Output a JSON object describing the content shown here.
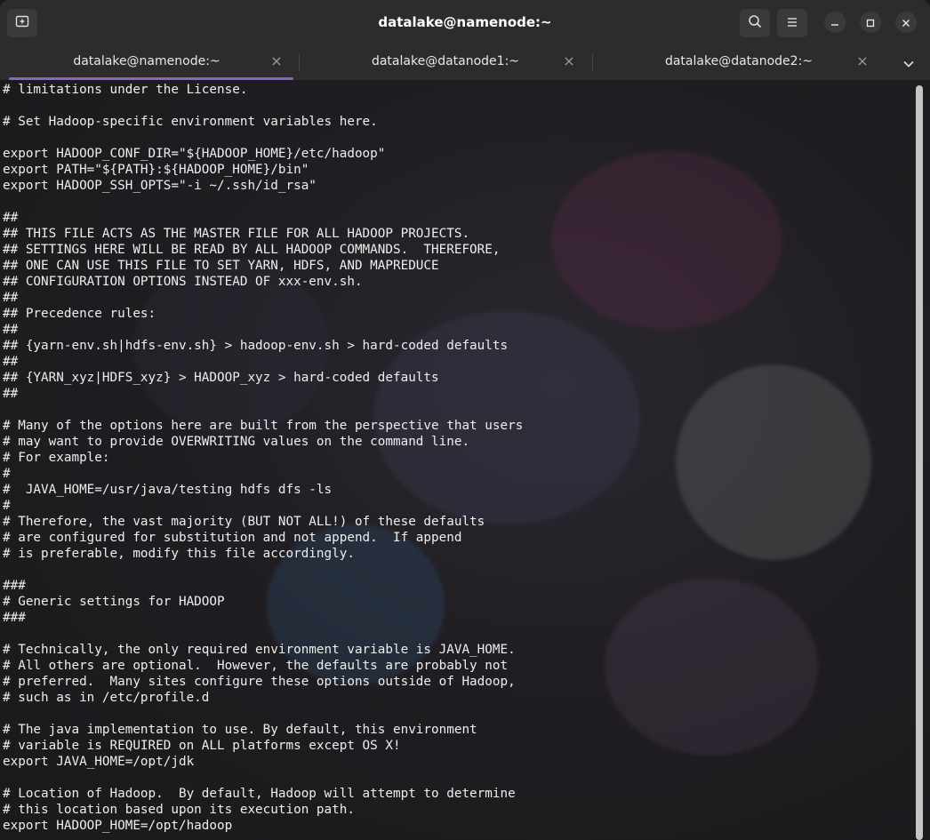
{
  "window": {
    "title": "datalake@namenode:~"
  },
  "tabs": [
    {
      "label": "datalake@namenode:~",
      "active": true
    },
    {
      "label": "datalake@datanode1:~",
      "active": false
    },
    {
      "label": "datalake@datanode2:~",
      "active": false
    }
  ],
  "icons": {
    "new_tab": "new-tab-icon",
    "search": "search-icon",
    "menu": "hamburger-menu-icon",
    "minimize": "minimize-icon",
    "maximize": "maximize-icon",
    "close": "close-icon",
    "tab_close": "×",
    "tabs_dropdown": "chevron-down-icon"
  },
  "colors": {
    "accent": "#8a63c8",
    "titlebar": "#2c2c2c",
    "terminal_text": "#eeeeee"
  },
  "terminal": {
    "lines": [
      "# limitations under the License.",
      "",
      "# Set Hadoop-specific environment variables here.",
      "",
      "export HADOOP_CONF_DIR=\"${HADOOP_HOME}/etc/hadoop\"",
      "export PATH=\"${PATH}:${HADOOP_HOME}/bin\"",
      "export HADOOP_SSH_OPTS=\"-i ~/.ssh/id_rsa\"",
      "",
      "##",
      "## THIS FILE ACTS AS THE MASTER FILE FOR ALL HADOOP PROJECTS.",
      "## SETTINGS HERE WILL BE READ BY ALL HADOOP COMMANDS.  THEREFORE,",
      "## ONE CAN USE THIS FILE TO SET YARN, HDFS, AND MAPREDUCE",
      "## CONFIGURATION OPTIONS INSTEAD OF xxx-env.sh.",
      "##",
      "## Precedence rules:",
      "##",
      "## {yarn-env.sh|hdfs-env.sh} > hadoop-env.sh > hard-coded defaults",
      "##",
      "## {YARN_xyz|HDFS_xyz} > HADOOP_xyz > hard-coded defaults",
      "##",
      "",
      "# Many of the options here are built from the perspective that users",
      "# may want to provide OVERWRITING values on the command line.",
      "# For example:",
      "#",
      "#  JAVA_HOME=/usr/java/testing hdfs dfs -ls",
      "#",
      "# Therefore, the vast majority (BUT NOT ALL!) of these defaults",
      "# are configured for substitution and not append.  If append",
      "# is preferable, modify this file accordingly.",
      "",
      "###",
      "# Generic settings for HADOOP",
      "###",
      "",
      "# Technically, the only required environment variable is JAVA_HOME.",
      "# All others are optional.  However, the defaults are probably not",
      "# preferred.  Many sites configure these options outside of Hadoop,",
      "# such as in /etc/profile.d",
      "",
      "# The java implementation to use. By default, this environment",
      "# variable is REQUIRED on ALL platforms except OS X!",
      "export JAVA_HOME=/opt/jdk",
      "",
      "# Location of Hadoop.  By default, Hadoop will attempt to determine",
      "# this location based upon its execution path.",
      "export HADOOP_HOME=/opt/hadoop"
    ]
  }
}
